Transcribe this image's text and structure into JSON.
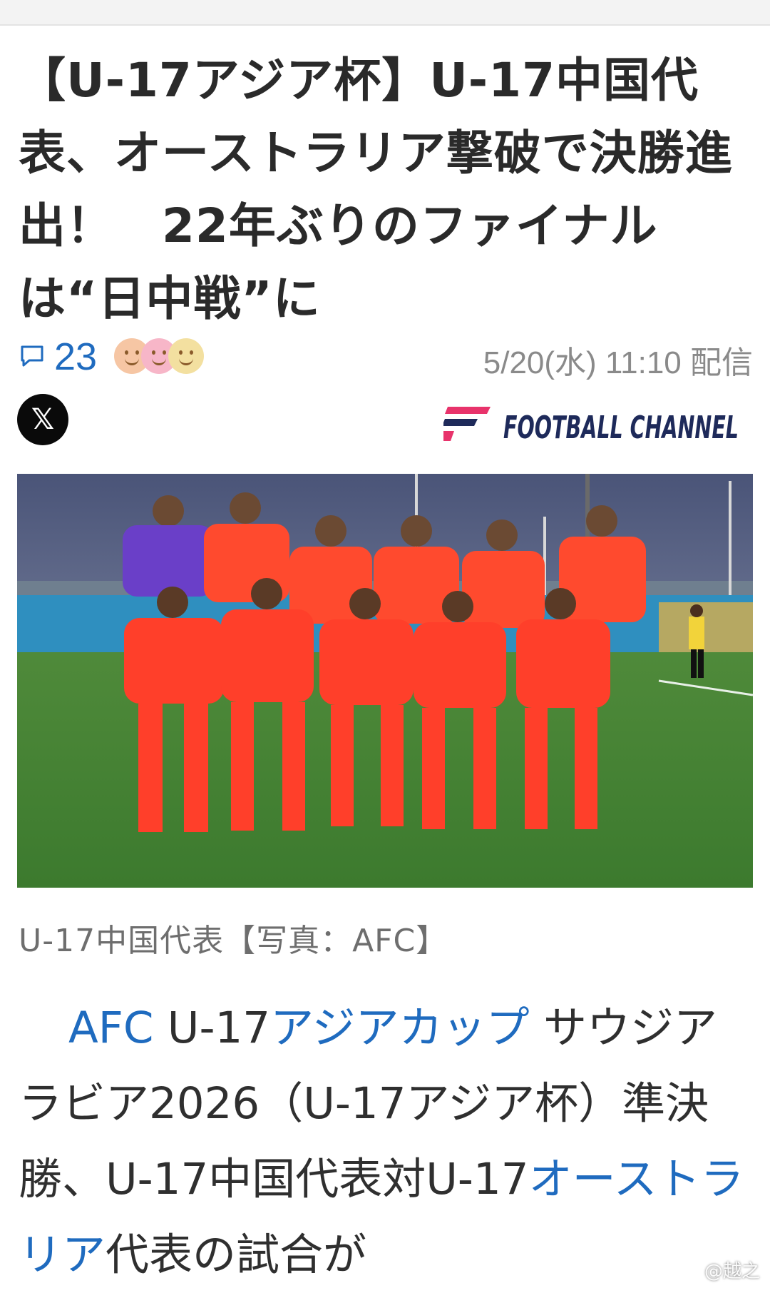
{
  "article": {
    "headline": "【U-17アジア杯】U-17中国代表、オーストラリア撃破で決勝進出！　22年ぶりのファイナルは“日中戦”に",
    "comment_count": "23",
    "published": "5/20(水) 11:10 配信",
    "share_icon": "x-logo-icon",
    "source_logo_text": "FOOTBALL CHANNEL",
    "photo_caption": "U-17中国代表【写真：AFC】",
    "photo_icon": "team-photo",
    "body": {
      "indent": "　",
      "link_1": "AFC",
      "text_1": " U-17",
      "link_2": "アジアカップ",
      "text_2": " サウジアラビア2026（U-17アジア杯）準決勝、U-17中国代表対U-17",
      "link_3": "オーストラリア",
      "text_3": "代表の試合が"
    }
  },
  "reactions": [
    {
      "icon": "smile-face-icon",
      "color": "#f6c6a4"
    },
    {
      "icon": "smile-face-icon",
      "color": "#f7b6c8"
    },
    {
      "icon": "smile-face-icon",
      "color": "#f3e0a0"
    }
  ],
  "watermark": "@越之",
  "colors": {
    "link": "#1f6bbf",
    "brand_pink": "#e8336b",
    "brand_navy": "#1e2a5a",
    "jersey": "#ff4a2e"
  }
}
